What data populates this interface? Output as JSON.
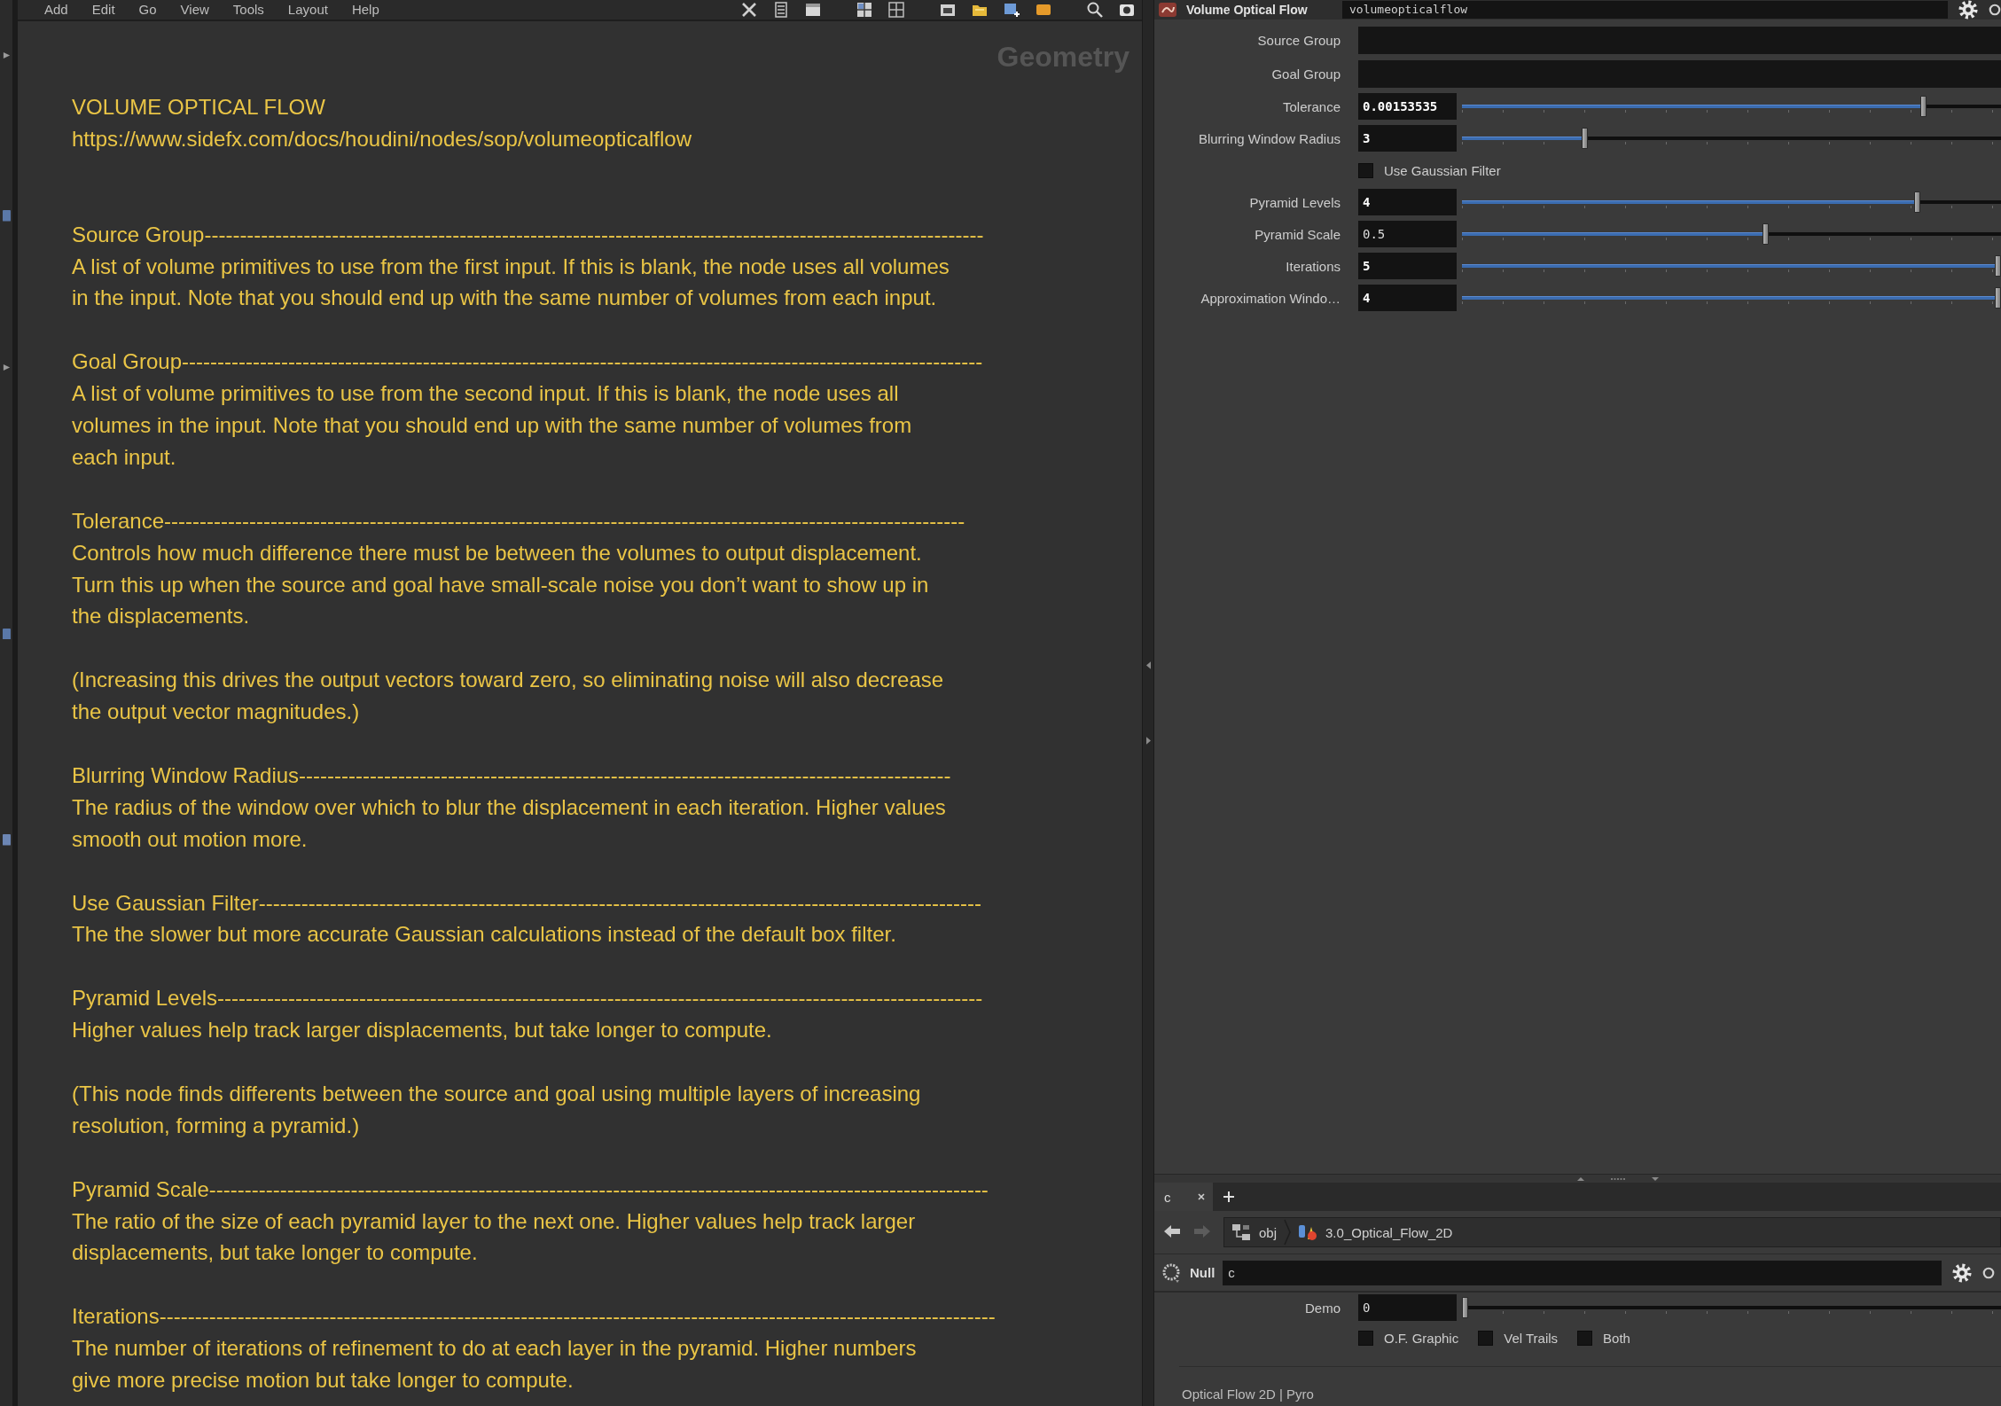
{
  "menu_bar": {
    "items": [
      "Add",
      "Edit",
      "Go",
      "View",
      "Tools",
      "Layout",
      "Help"
    ]
  },
  "network_editor": {
    "context_label": "Geometry",
    "note": {
      "title": "VOLUME OPTICAL FLOW",
      "url": "https://www.sidefx.com/docs/houdini/nodes/sop/volumeopticalflow",
      "sections": [
        {
          "heading": "Source Group--------------------------------------------------------------------------------------------------------------",
          "paragraphs": [
            "A list of volume primitives to use from the first input. If this is blank, the node uses all volumes\nin the input. Note that you should end up with the same number of volumes from each input."
          ]
        },
        {
          "heading": "Goal Group-----------------------------------------------------------------------------------------------------------------",
          "paragraphs": [
            "A list of volume primitives to use from the second input. If this is blank, the node uses all\nvolumes in the input. Note that you should end up with the same number of volumes from\neach input."
          ]
        },
        {
          "heading": "Tolerance-----------------------------------------------------------------------------------------------------------------",
          "paragraphs": [
            "Controls how much difference there must be between the volumes to output displacement.\nTurn this up when the source and goal have small-scale noise you don’t want to show up in\nthe displacements.",
            "(Increasing this drives the output vectors toward zero, so eliminating noise will also decrease\nthe output vector magnitudes.)"
          ]
        },
        {
          "heading": "Blurring Window Radius--------------------------------------------------------------------------------------------",
          "paragraphs": [
            "The radius of the window over which to blur the displacement in each iteration. Higher values\nsmooth out motion more."
          ]
        },
        {
          "heading": "Use Gaussian Filter------------------------------------------------------------------------------------------------------",
          "paragraphs": [
            "The the slower but more accurate Gaussian calculations instead of the default box filter."
          ]
        },
        {
          "heading": "Pyramid Levels------------------------------------------------------------------------------------------------------------",
          "paragraphs": [
            "Higher values help track larger displacements, but take longer to compute.",
            "(This node finds differents between the source and goal using multiple layers of increasing\nresolution, forming a pyramid.)"
          ]
        },
        {
          "heading": "Pyramid Scale--------------------------------------------------------------------------------------------------------------",
          "paragraphs": [
            "The ratio of the size of each pyramid layer to the next one. Higher values help track larger\ndisplacements, but take longer to compute."
          ]
        },
        {
          "heading": "Iterations----------------------------------------------------------------------------------------------------------------------",
          "paragraphs": [
            "The number of iterations of refinement to do at each layer in the pyramid. Higher numbers\ngive more precise motion but take longer to compute."
          ]
        }
      ]
    }
  },
  "parameter_editor": {
    "node_type": "Volume Optical Flow",
    "node_name": "volumeopticalflow",
    "parameters": [
      {
        "kind": "text",
        "label": "Source Group"
      },
      {
        "kind": "text",
        "label": "Goal Group"
      },
      {
        "kind": "slider",
        "label": "Tolerance",
        "value": "0.00153535",
        "changed": true,
        "level": 0.86
      },
      {
        "kind": "slider",
        "label": "Blurring Window Radius",
        "value": "3",
        "changed": true,
        "level": 0.225
      },
      {
        "kind": "checkbox",
        "label": "Use Gaussian Filter",
        "checked": false
      },
      {
        "kind": "slider",
        "label": "Pyramid Levels",
        "value": "4",
        "changed": true,
        "level": 0.848
      },
      {
        "kind": "slider",
        "label": "Pyramid Scale",
        "value": "0.5",
        "changed": false,
        "level": 0.564
      },
      {
        "kind": "slider",
        "label": "Iterations",
        "value": "5",
        "changed": true,
        "level": 1
      },
      {
        "kind": "slider",
        "label": "Approximation Windo…",
        "value": "4",
        "changed": true,
        "level": 1
      }
    ]
  },
  "bottom_pane": {
    "tabs": [
      {
        "label": "c",
        "selected": true
      }
    ],
    "path": [
      {
        "kind": "network",
        "label": "obj"
      },
      {
        "kind": "geometry",
        "label": "3.0_Optical_Flow_2D"
      }
    ],
    "node_type": "Null",
    "node_name": "c",
    "parameters": [
      {
        "kind": "slider",
        "label": "Demo",
        "value": "0",
        "changed": false,
        "level": 0
      }
    ],
    "toggles": [
      {
        "label": "O.F. Graphic",
        "checked": false
      },
      {
        "label": "Vel Trails",
        "checked": false
      },
      {
        "label": "Both",
        "checked": false
      }
    ],
    "footer": "Optical Flow 2D | Pyro"
  }
}
